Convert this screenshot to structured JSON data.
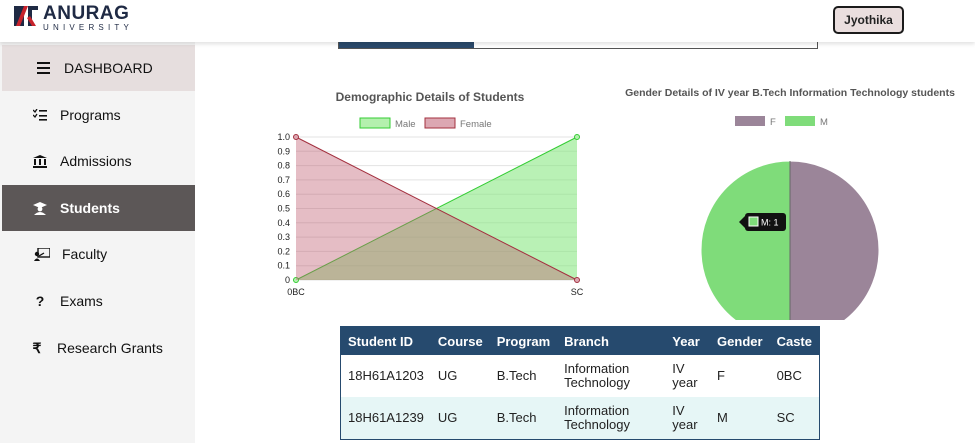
{
  "brand": {
    "name": "ANURAG",
    "sub": "UNIVERSITY"
  },
  "user": {
    "name": "Jyothika"
  },
  "sidebar": {
    "items": [
      {
        "label": "DASHBOARD",
        "icon": "menu-icon"
      },
      {
        "label": "Programs",
        "icon": "list-icon"
      },
      {
        "label": "Admissions",
        "icon": "institution-icon"
      },
      {
        "label": "Students",
        "icon": "student-icon"
      },
      {
        "label": "Faculty",
        "icon": "teacher-icon"
      },
      {
        "label": "Exams",
        "icon": "question-icon"
      },
      {
        "label": "Research Grants",
        "icon": "rupee-icon"
      }
    ]
  },
  "colors": {
    "male": "#7fdc7a",
    "female": "#9b8599",
    "line_male": "#33cc33",
    "line_female": "#a3303f",
    "header": "#264a6e",
    "active_nav": "#5c5757"
  },
  "chart_data": [
    {
      "type": "area",
      "title": "Demographic Details of Students",
      "categories": [
        "0BC",
        "SC"
      ],
      "series": [
        {
          "name": "Male",
          "values": [
            0,
            1
          ]
        },
        {
          "name": "Female",
          "values": [
            1,
            0
          ]
        }
      ],
      "ylim": [
        0,
        1.0
      ],
      "yticks": [
        "0",
        "0.1",
        "0.2",
        "0.3",
        "0.4",
        "0.5",
        "0.6",
        "0.7",
        "0.8",
        "0.9",
        "1.0"
      ],
      "legend": "top",
      "grid": true
    },
    {
      "type": "pie",
      "title": "Gender Details of IV year B.Tech Information Technology students",
      "categories": [
        "F",
        "M"
      ],
      "values": [
        1,
        1
      ],
      "legend": "top",
      "tooltip": "M: 1"
    }
  ],
  "table": {
    "headers": [
      "Student ID",
      "Course",
      "Program",
      "Branch",
      "Year",
      "Gender",
      "Caste"
    ],
    "rows": [
      [
        "18H61A1203",
        "UG",
        "B.Tech",
        "Information Technology",
        "IV year",
        "F",
        "0BC"
      ],
      [
        "18H61A1239",
        "UG",
        "B.Tech",
        "Information Technology",
        "IV year",
        "M",
        "SC"
      ]
    ]
  }
}
